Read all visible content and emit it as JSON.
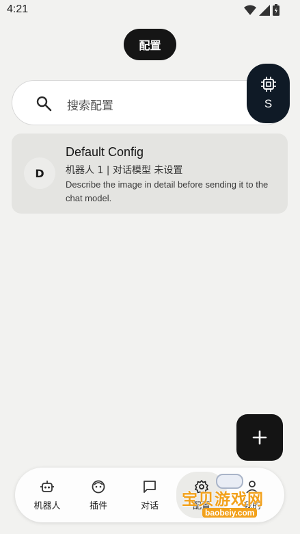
{
  "status_bar": {
    "time": "4:21"
  },
  "header": {
    "title": "配置"
  },
  "search": {
    "placeholder": "搜索配置"
  },
  "model_fab": {
    "label": "S"
  },
  "configs": [
    {
      "avatar": "D",
      "title": "Default Config",
      "subtitle": "机器人 1 | 对话模型 未设置",
      "description": "Describe the image in detail before sending it to the chat model."
    }
  ],
  "bottom_nav": {
    "items": [
      {
        "label": "机器人",
        "icon": "robot-icon"
      },
      {
        "label": "插件",
        "icon": "plugin-icon"
      },
      {
        "label": "对话",
        "icon": "chat-icon"
      },
      {
        "label": "配置",
        "icon": "gear-icon",
        "active": true
      },
      {
        "label": "我的",
        "icon": "person-icon"
      }
    ]
  },
  "watermark": {
    "text": "宝贝游戏网",
    "url": "baobeiy.com"
  },
  "colors": {
    "accent": "#151515",
    "fab_dark": "#0f1a26",
    "card_bg": "#e4e4e1",
    "watermark": "#f2a11b"
  }
}
